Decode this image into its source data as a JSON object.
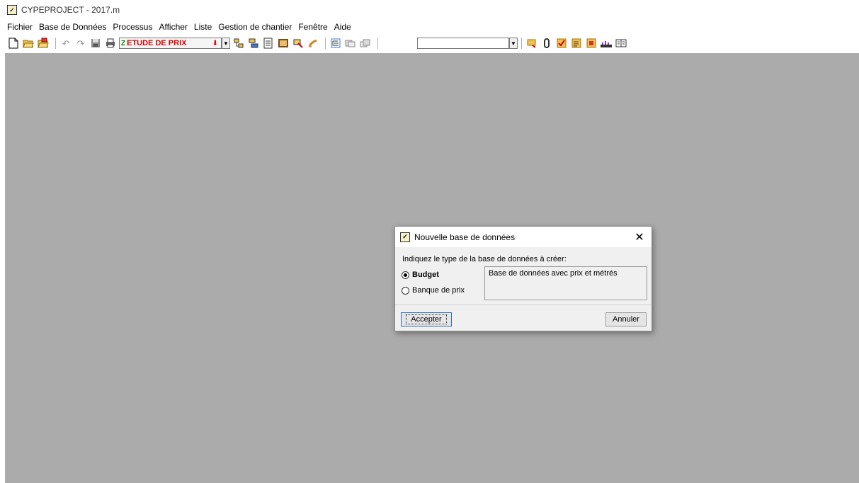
{
  "window": {
    "title": "CYPEPROJECT - 2017.m"
  },
  "menu": [
    "Fichier",
    "Base de Données",
    "Processus",
    "Afficher",
    "Liste",
    "Gestion de chantier",
    "Fenêtre",
    "Aide"
  ],
  "toolbar": {
    "left_icons": [
      "new-file-icon",
      "open-folder-icon",
      "open-folder-search-icon"
    ],
    "undo_icons": [
      "undo-icon",
      "redo-icon",
      "save-icon",
      "print-icon"
    ],
    "study_combo": {
      "badge": "Z",
      "value": "ETUDE DE PRIX"
    },
    "mid_icons": [
      "add-chapter-icon",
      "insert-icon",
      "document-icon",
      "image-icon",
      "tool-icon",
      "paint-icon"
    ],
    "tree_icons": [
      "tree-icon",
      "copy-icon",
      "paste-icon"
    ],
    "right_icons": [
      "comment-icon",
      "clip-icon",
      "check-icon",
      "checklist-icon",
      "report-icon",
      "chart-icon",
      "book-icon"
    ]
  },
  "dialog": {
    "title": "Nouvelle base de données",
    "prompt": "Indiquez le type de la base de données à créer:",
    "options": [
      {
        "label": "Budget",
        "selected": true
      },
      {
        "label": "Banque de prix",
        "selected": false
      }
    ],
    "description": "Base de données avec prix et métrés",
    "accept_label": "Accepter",
    "cancel_label": "Annuler",
    "close_glyph": "✕"
  }
}
